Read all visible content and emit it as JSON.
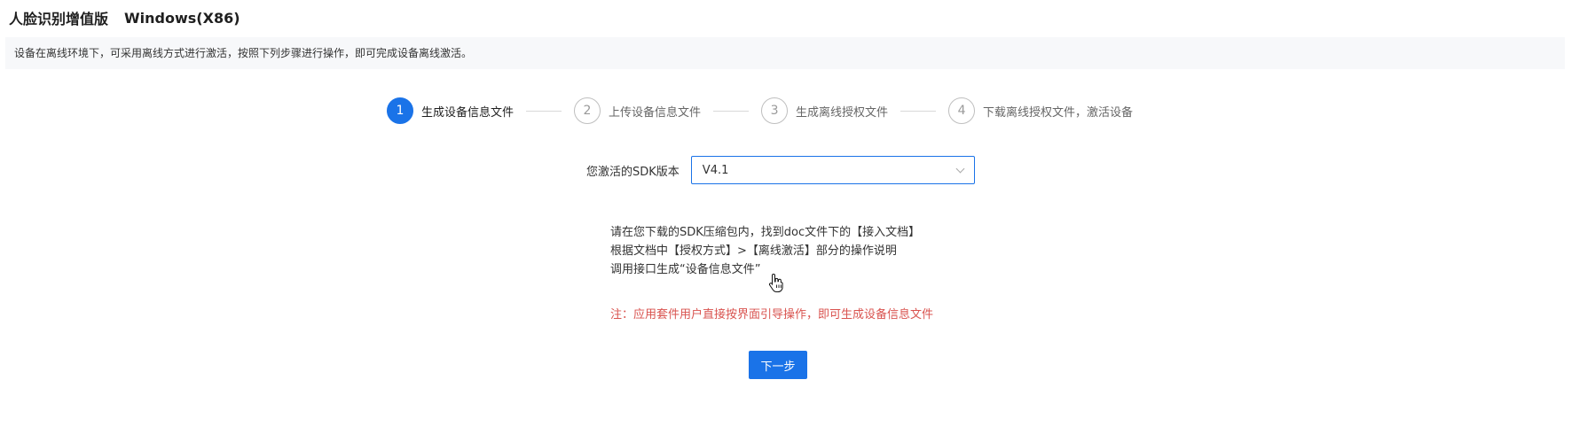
{
  "header": {
    "title": "人脸识别增值版",
    "platform": "Windows(X86)"
  },
  "notice": "设备在离线环境下，可采用离线方式进行激活，按照下列步骤进行操作，即可完成设备离线激活。",
  "steps": [
    {
      "number": "1",
      "label": "生成设备信息文件",
      "active": true
    },
    {
      "number": "2",
      "label": "上传设备信息文件",
      "active": false
    },
    {
      "number": "3",
      "label": "生成离线授权文件",
      "active": false
    },
    {
      "number": "4",
      "label": "下载离线授权文件，激活设备",
      "active": false
    }
  ],
  "sdk": {
    "label": "您激活的SDK版本",
    "selected": "V4.1"
  },
  "instructions": [
    "请在您下载的SDK压缩包内，找到doc文件下的【接入文档】",
    "根据文档中【授权方式】>【离线激活】部分的操作说明",
    "调用接口生成“设备信息文件”"
  ],
  "note": "注：应用套件用户直接按界面引导操作，即可生成设备信息文件",
  "next_button": "下一步",
  "colors": {
    "accent": "#1a73e8",
    "note": "#d9534f"
  }
}
